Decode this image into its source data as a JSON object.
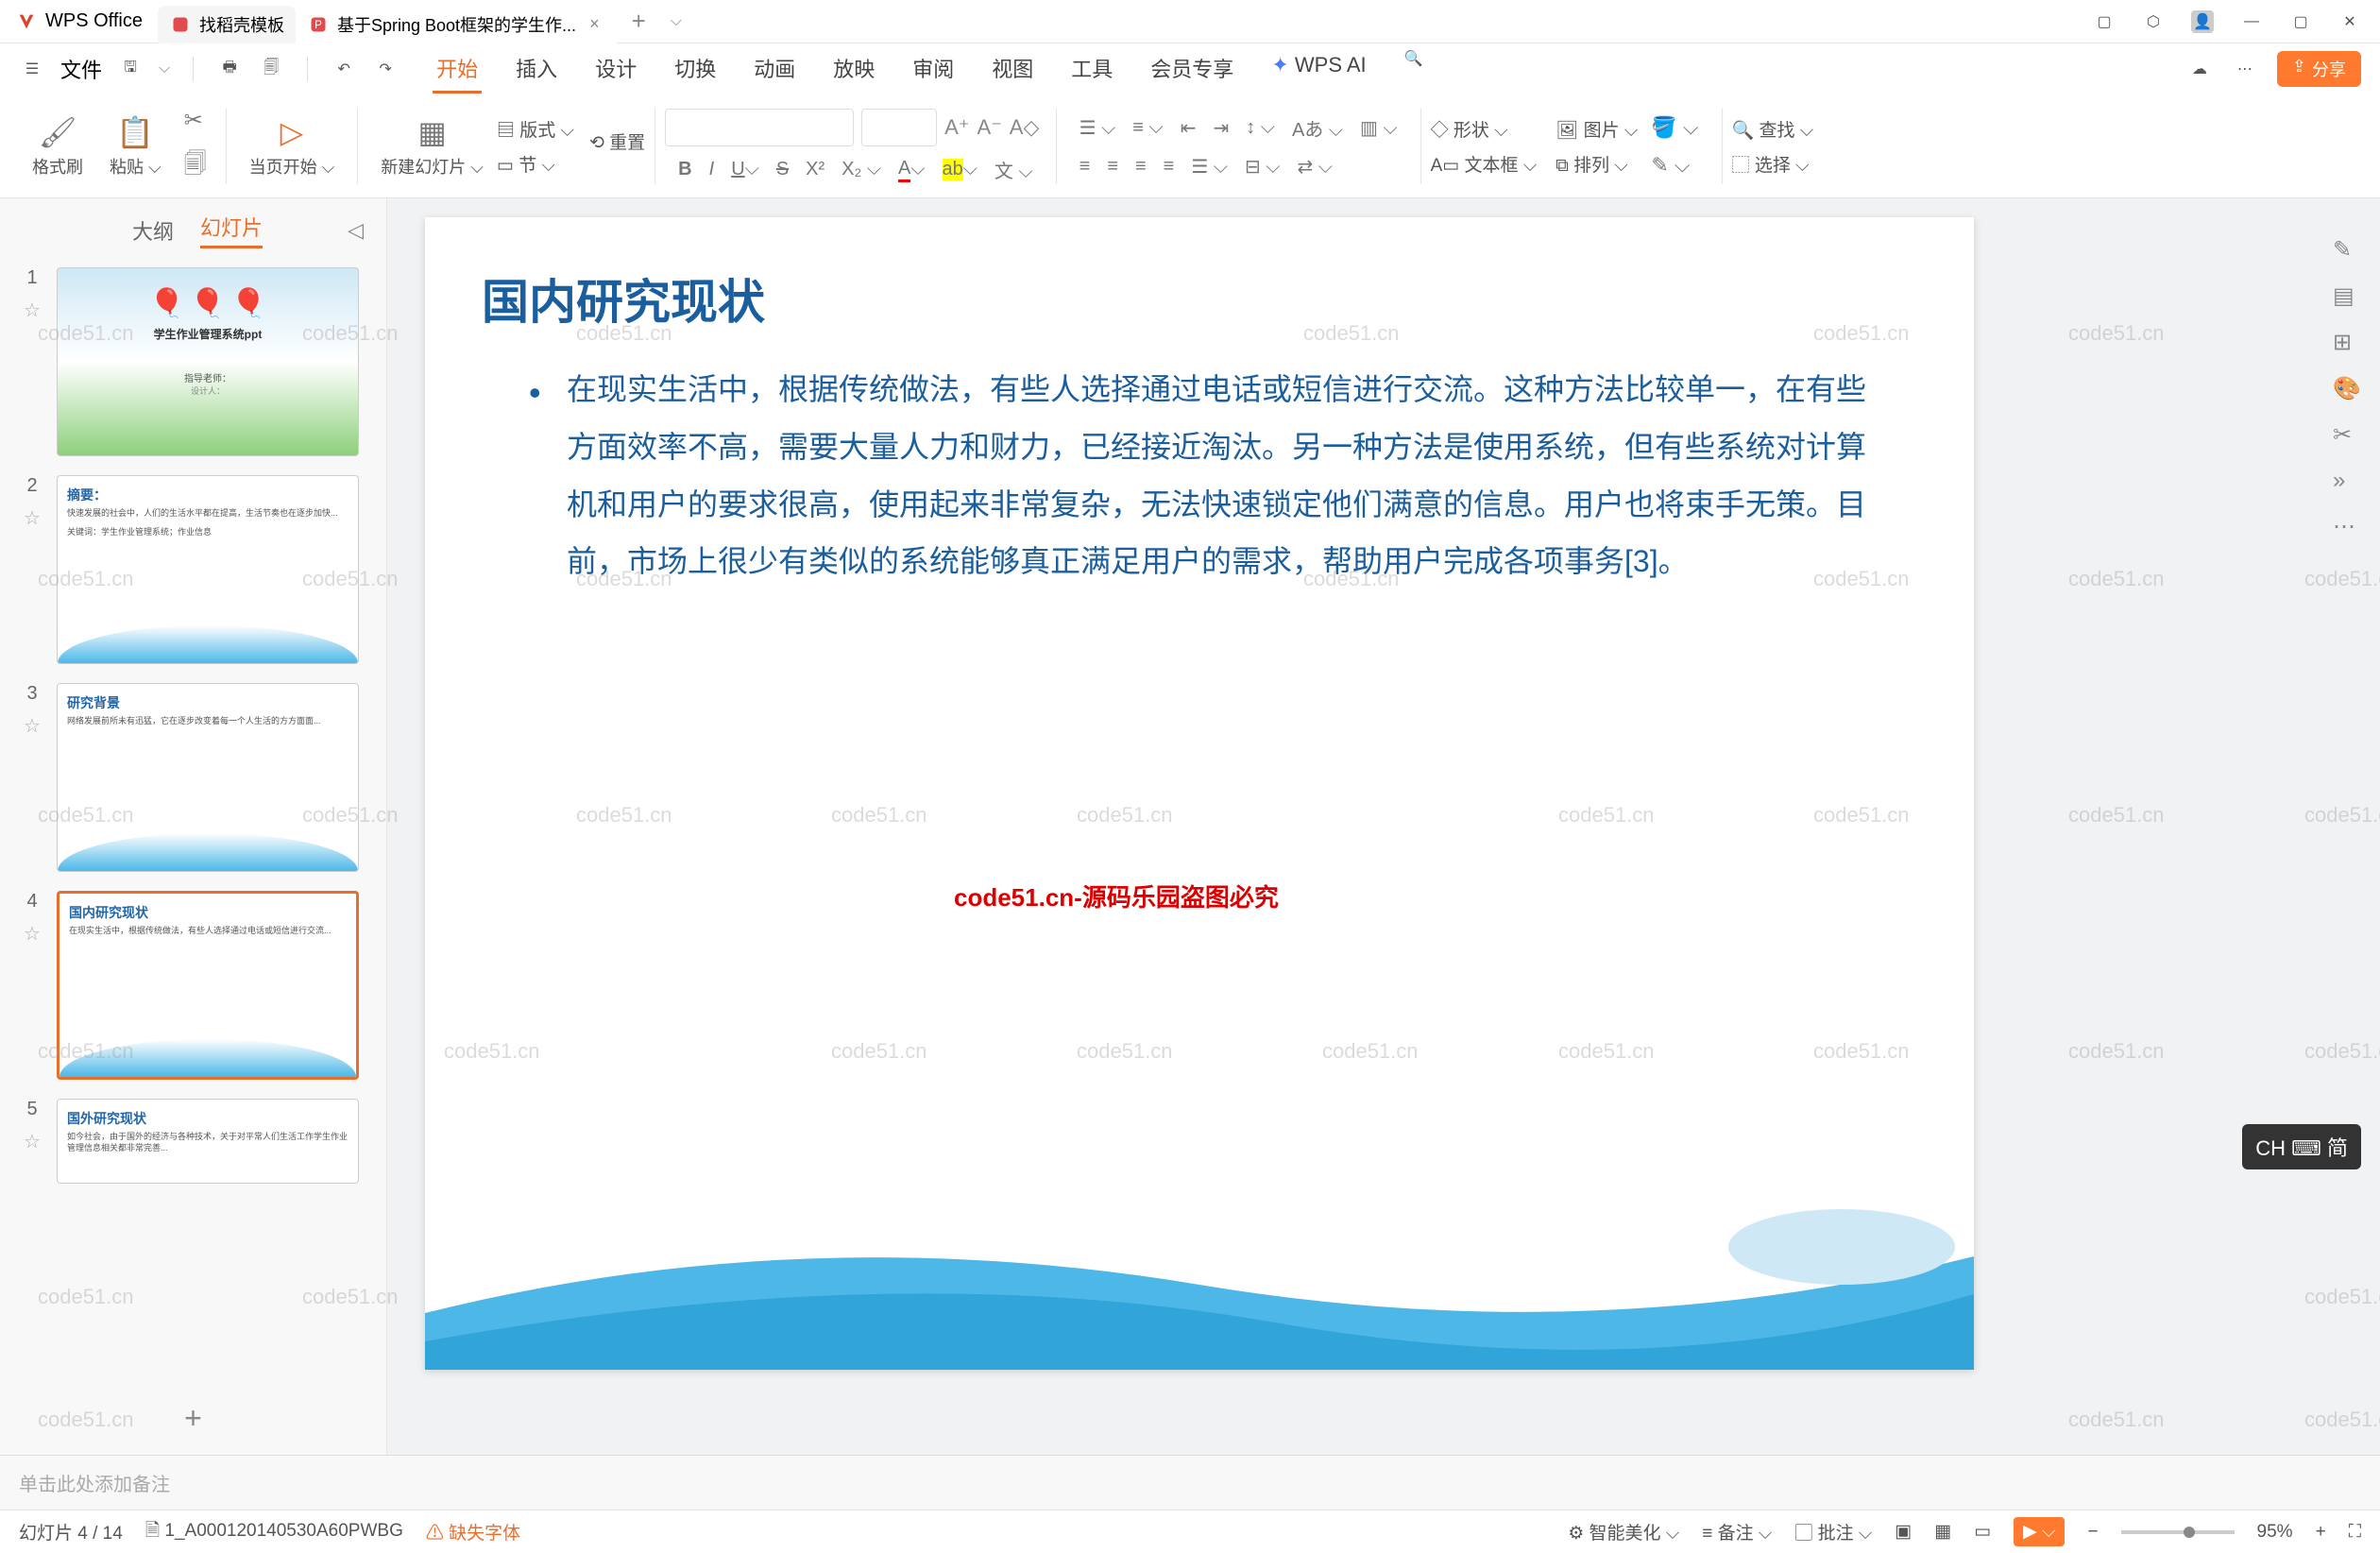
{
  "titlebar": {
    "app_name": "WPS Office",
    "tabs": [
      {
        "label": "找稻壳模板"
      },
      {
        "label": "基于Spring Boot框架的学生作..."
      }
    ],
    "close": "×",
    "add": "+"
  },
  "menubar": {
    "file": "文件",
    "tabs": [
      "开始",
      "插入",
      "设计",
      "切换",
      "动画",
      "放映",
      "审阅",
      "视图",
      "工具",
      "会员专享"
    ],
    "ai": "WPS AI",
    "share": "分享"
  },
  "ribbon": {
    "format_painter": "格式刷",
    "paste": "粘贴",
    "from_current": "当页开始",
    "new_slide": "新建幻灯片",
    "layout": "版式",
    "reset": "重置",
    "section": "节",
    "shape": "形状",
    "picture": "图片",
    "textbox": "文本框",
    "arrange": "排列",
    "find": "查找",
    "select": "选择"
  },
  "sidepanel": {
    "tab_outline": "大纲",
    "tab_slides": "幻灯片",
    "slides": [
      {
        "num": "1",
        "title": "学生作业管理系统ppt",
        "sub": "指导老师：",
        "sub2": "设计人："
      },
      {
        "num": "2",
        "title": "摘要：",
        "body": "快速发展的社会中，人们的生活水平都在提高，生活节奏也在逐步加快...",
        "kw": "关键词：学生作业管理系统；作业信息"
      },
      {
        "num": "3",
        "title": "研究背景",
        "body": "网络发展前所未有迅猛，它在逐步改变着每一个人生活的方方面面..."
      },
      {
        "num": "4",
        "title": "国内研究现状",
        "body": "在现实生活中，根据传统做法，有些人选择通过电话或短信进行交流..."
      },
      {
        "num": "5",
        "title": "国外研究现状",
        "body": "如今社会，由于国外的经济与各种技术，关于对平常人们生活工作学生作业管理信息相关都非常完善..."
      }
    ],
    "add": "+"
  },
  "slide": {
    "title": "国内研究现状",
    "bullet": "在现实生活中，根据传统做法，有些人选择通过电话或短信进行交流。这种方法比较单一，在有些方面效率不高，需要大量人力和财力，已经接近淘汰。另一种方法是使用系统，但有些系统对计算机和用户的要求很高，使用起来非常复杂，无法快速锁定他们满意的信息。用户也将束手无策。目前，市场上很少有类似的系统能够真正满足用户的需求，帮助用户完成各项事务[3]。"
  },
  "notes": "单击此处添加备注",
  "statusbar": {
    "slide_count": "幻灯片 4 / 14",
    "docid": "1_A000120140530A60PWBG",
    "missing_font": "缺失字体",
    "beautify": "智能美化",
    "notes_btn": "备注",
    "comments": "批注",
    "zoom": "95%"
  },
  "ime": "CH ⌨ 简",
  "watermark": "code51.cn",
  "watermark_red": "code51.cn-源码乐园盗图必究"
}
